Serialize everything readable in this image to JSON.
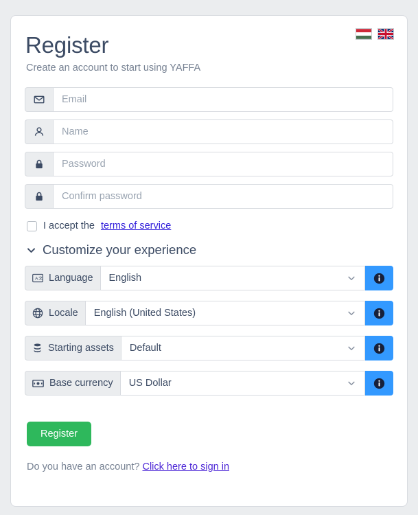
{
  "page": {
    "background_color": "#ebedef",
    "card_background": "#ffffff"
  },
  "header": {
    "title": "Register",
    "subtitle": "Create an account to start using YAFFA"
  },
  "language_flags": [
    {
      "name": "hungarian-flag",
      "label": "Hungarian",
      "colors": [
        "#ce2939",
        "#ffffff",
        "#477050"
      ]
    },
    {
      "name": "uk-flag",
      "label": "English",
      "colors": [
        "#012169",
        "#ffffff",
        "#c8102e"
      ]
    }
  ],
  "form": {
    "fields": [
      {
        "name": "email",
        "icon": "envelope-icon",
        "placeholder": "Email",
        "value": "",
        "type": "email"
      },
      {
        "name": "name",
        "icon": "user-icon",
        "placeholder": "Name",
        "value": "",
        "type": "text"
      },
      {
        "name": "password",
        "icon": "lock-icon",
        "placeholder": "Password",
        "value": "",
        "type": "password"
      },
      {
        "name": "confirm-password",
        "icon": "lock-icon",
        "placeholder": "Confirm password",
        "value": "",
        "type": "password"
      }
    ],
    "terms": {
      "checked": false,
      "text_before": "I accept the",
      "link_label": "terms of service"
    },
    "customize": {
      "chevron": "chevron-down-icon",
      "heading": "Customize your experience",
      "expanded": true
    },
    "settings": [
      {
        "name": "language",
        "icon": "translate-icon",
        "label": "Language",
        "value": "English",
        "options": [
          "English"
        ],
        "info_button": "info-icon"
      },
      {
        "name": "locale",
        "icon": "globe-icon",
        "label": "Locale",
        "value": "English (United States)",
        "options": [
          "English (United States)"
        ],
        "info_button": "info-icon"
      },
      {
        "name": "starting-assets",
        "icon": "database-icon",
        "label": "Starting assets",
        "value": "Default",
        "options": [
          "Default"
        ],
        "info_button": "info-icon"
      },
      {
        "name": "base-currency",
        "icon": "banknote-icon",
        "label": "Base currency",
        "value": "US Dollar",
        "options": [
          "US Dollar"
        ],
        "info_button": "info-icon"
      }
    ],
    "submit_label": "Register"
  },
  "footer": {
    "text": "Do you have an account?",
    "link_label": "Click here to sign in"
  },
  "colors": {
    "accent_green": "#2eb85c",
    "accent_blue": "#3399ff",
    "link": "#321fdb",
    "text": "#3c4b64",
    "muted": "#768192",
    "border": "#d8dbe0",
    "prepend_bg": "#ebedef"
  }
}
